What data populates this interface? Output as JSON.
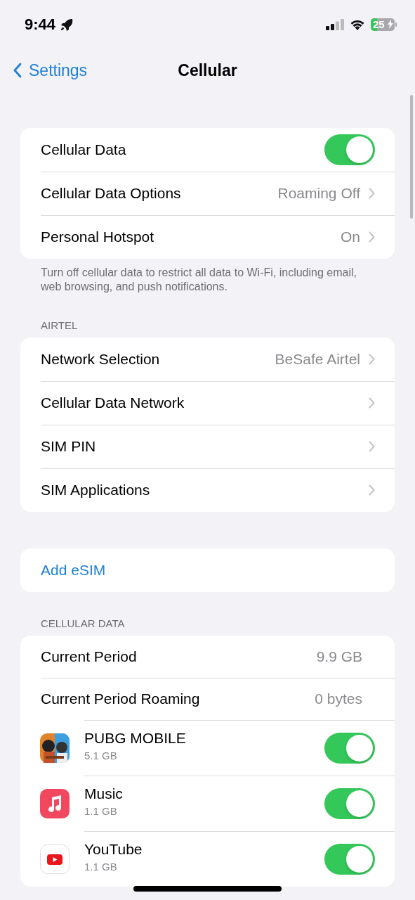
{
  "status_bar": {
    "time": "9:44",
    "battery": "25"
  },
  "nav": {
    "back": "Settings",
    "title": "Cellular"
  },
  "sections": [
    {
      "rows": [
        {
          "kind": "toggle",
          "label": "Cellular Data",
          "on": true
        },
        {
          "kind": "nav",
          "label": "Cellular Data Options",
          "value": "Roaming Off"
        },
        {
          "kind": "nav",
          "label": "Personal Hotspot",
          "value": "On"
        }
      ],
      "footer": "Turn off cellular data to restrict all data to Wi-Fi, including email, web browsing, and push notifications."
    },
    {
      "header": "AIRTEL",
      "rows": [
        {
          "kind": "nav",
          "label": "Network Selection",
          "value": "BeSafe Airtel"
        },
        {
          "kind": "nav",
          "label": "Cellular Data Network"
        },
        {
          "kind": "nav",
          "label": "SIM PIN"
        },
        {
          "kind": "nav",
          "label": "SIM Applications"
        }
      ]
    },
    {
      "rows": [
        {
          "kind": "action",
          "label": "Add eSIM"
        }
      ]
    },
    {
      "header": "CELLULAR DATA",
      "rows": [
        {
          "kind": "value",
          "label": "Current Period",
          "value": "9.9 GB"
        },
        {
          "kind": "value",
          "label": "Current Period Roaming",
          "value": "0 bytes"
        },
        {
          "kind": "app",
          "label": "PUBG MOBILE",
          "usage": "5.1 GB",
          "on": true
        },
        {
          "kind": "app",
          "label": "Music",
          "usage": "1.1 GB",
          "on": true
        },
        {
          "kind": "app",
          "label": "YouTube",
          "usage": "1.1 GB",
          "on": true
        }
      ]
    }
  ]
}
